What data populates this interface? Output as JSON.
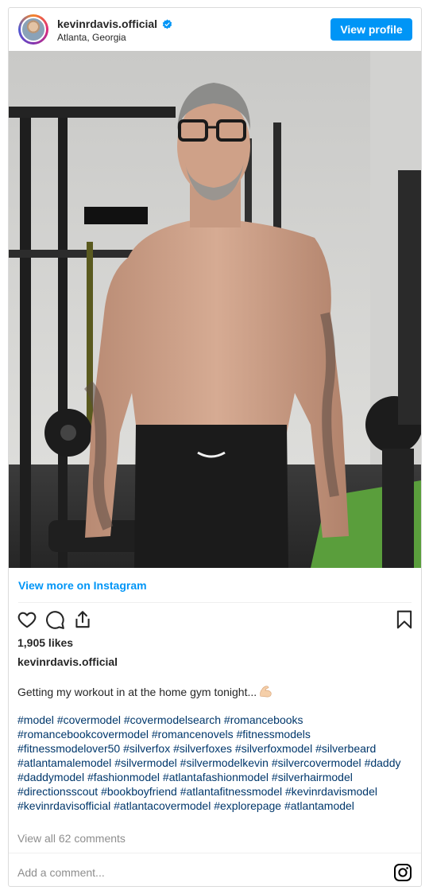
{
  "header": {
    "username": "kevinrdavis.official",
    "location": "Atlanta, Georgia",
    "view_profile_label": "View profile"
  },
  "photo": {
    "alt": "kevinrdavis.official shirtless in home gym"
  },
  "links": {
    "view_more": "View more on Instagram"
  },
  "stats": {
    "likes": "1,905 likes"
  },
  "post": {
    "owner": "kevinrdavis.official",
    "caption": "Getting my workout in at the home gym tonight...",
    "hashtags": [
      "#model",
      "#covermodel",
      "#covermodelsearch",
      "#romancebooks",
      "#romancebookcovermodel",
      "#romancenovels",
      "#fitnessmodels",
      "#fitnessmodelover50",
      "#silverfox",
      "#silverfoxes",
      "#silverfoxmodel",
      "#silverbeard",
      "#atlantamalemodel",
      "#silvermodel",
      "#silvermodelkevin",
      "#silvercovermodel",
      "#daddy",
      "#daddymodel",
      "#fashionmodel",
      "#atlantafashionmodel",
      "#silverhairmodel",
      "#directionsscout",
      "#bookboyfriend",
      "#atlantafitnessmodel",
      "#kevinrdavismodel",
      "#kevinrdavisofficial",
      "#atlantacovermodel",
      "#explorepage",
      "#atlantamodel"
    ],
    "view_comments": "View all 62 comments"
  },
  "comment": {
    "placeholder": "Add a comment..."
  },
  "colors": {
    "accent": "#0095f6",
    "hashtag": "#00376b",
    "muted": "#8e8e8e",
    "border": "#dbdbdb"
  },
  "icons": [
    "verified-badge-icon",
    "heart-icon",
    "comment-icon",
    "share-icon",
    "bookmark-icon",
    "flexed-biceps-emoji-icon",
    "instagram-icon"
  ]
}
